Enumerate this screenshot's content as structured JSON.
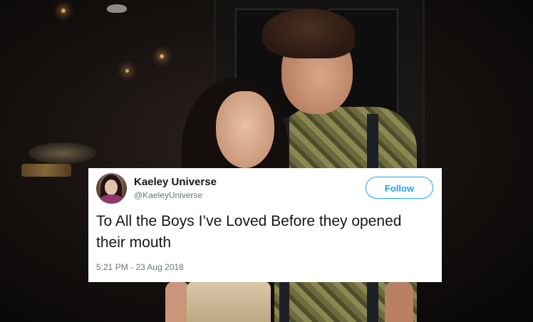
{
  "tweet": {
    "display_name": "Kaeley Universe",
    "handle": "@KaeleyUniverse",
    "follow_label": "Follow",
    "text": "To All the Boys I’ve Loved Before they opened their mouth",
    "timestamp": "5:21 PM - 23 Aug 2018"
  },
  "colors": {
    "accent": "#1da1f2",
    "text_primary": "#14171a",
    "text_secondary": "#657786",
    "card_background": "#ffffff"
  },
  "icons": {
    "avatar": "user-avatar-photo"
  }
}
